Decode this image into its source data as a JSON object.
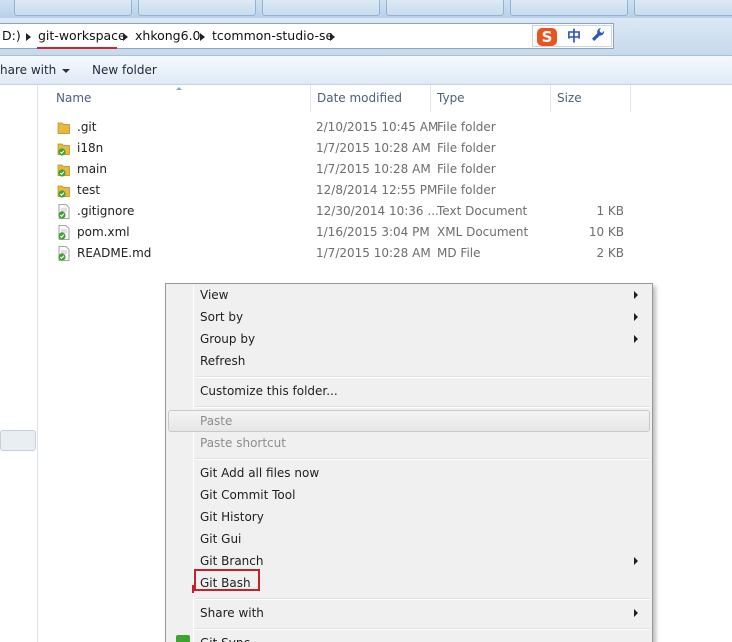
{
  "breadcrumb": {
    "drive": "D:)",
    "items": [
      "git-workspace",
      "xhkong6.0",
      "tcommon-studio-se"
    ]
  },
  "ime": {
    "lang": "中",
    "logo": "S",
    "tool_icon": "wrench-icon"
  },
  "toolbar": {
    "share_label": "hare with",
    "new_folder_label": "New folder"
  },
  "columns": {
    "name": "Name",
    "date": "Date modified",
    "type": "Type",
    "size": "Size"
  },
  "files": [
    {
      "name": ".git",
      "date": "2/10/2015 10:45 AM",
      "type": "File folder",
      "size": "",
      "icon": "folder-icon"
    },
    {
      "name": "i18n",
      "date": "1/7/2015 10:28 AM",
      "type": "File folder",
      "size": "",
      "icon": "git-folder-icon"
    },
    {
      "name": "main",
      "date": "1/7/2015 10:28 AM",
      "type": "File folder",
      "size": "",
      "icon": "git-folder-icon"
    },
    {
      "name": "test",
      "date": "12/8/2014 12:55 PM",
      "type": "File folder",
      "size": "",
      "icon": "git-folder-icon"
    },
    {
      "name": ".gitignore",
      "date": "12/30/2014 10:36 ...",
      "type": "Text Document",
      "size": "1 KB",
      "icon": "git-file-icon"
    },
    {
      "name": "pom.xml",
      "date": "1/16/2015 3:04 PM",
      "type": "XML Document",
      "size": "10 KB",
      "icon": "git-file-icon"
    },
    {
      "name": "README.md",
      "date": "1/7/2015 10:28 AM",
      "type": "MD File",
      "size": "2 KB",
      "icon": "git-file-icon"
    }
  ],
  "context_menu": {
    "view": "View",
    "sort_by": "Sort by",
    "group_by": "Group by",
    "refresh": "Refresh",
    "customize": "Customize this folder...",
    "paste": "Paste",
    "paste_shortcut": "Paste shortcut",
    "git_add_all": "Git Add all files now",
    "git_commit_tool": "Git Commit Tool",
    "git_history": "Git History",
    "git_gui": "Git Gui",
    "git_branch": "Git Branch",
    "git_bash": "Git Bash",
    "share_with": "Share with",
    "git_sync": "Git Sync..."
  },
  "colors": {
    "annotation_red": "#c0282e",
    "folder_yellow": "#e8b840",
    "git_green": "#3fa32f"
  }
}
